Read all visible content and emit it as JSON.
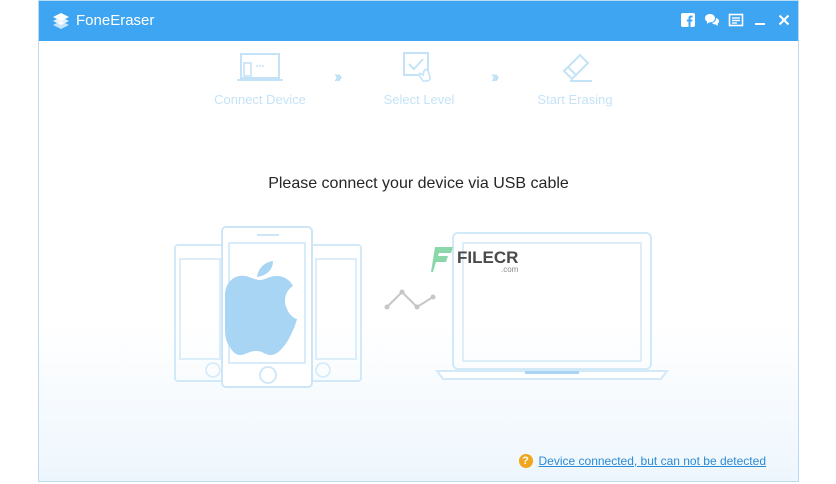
{
  "window": {
    "title": "FoneEraser"
  },
  "titlebar": {
    "buttons": [
      {
        "icon": "facebook-icon"
      },
      {
        "icon": "feedback-icon"
      },
      {
        "icon": "register-icon"
      },
      {
        "icon": "minimize-icon"
      },
      {
        "icon": "close-icon"
      }
    ]
  },
  "steps": [
    {
      "label": "Connect Device",
      "icon": "connect-device-icon"
    },
    {
      "label": "Select Level",
      "icon": "select-level-icon"
    },
    {
      "label": "Start Erasing",
      "icon": "eraser-icon"
    }
  ],
  "main": {
    "headline": "Please connect your device via USB cable"
  },
  "watermark": {
    "text": "FILECR",
    "suffix": ".com"
  },
  "footer": {
    "help_link": "Device connected, but can not be detected",
    "help_icon": "question-icon",
    "help_symbol": "?"
  },
  "colors": {
    "titlebar": "#3ea5f2",
    "accent_light": "#c5e3f7",
    "link": "#2a8bd6",
    "help_icon": "#f1a51d"
  }
}
